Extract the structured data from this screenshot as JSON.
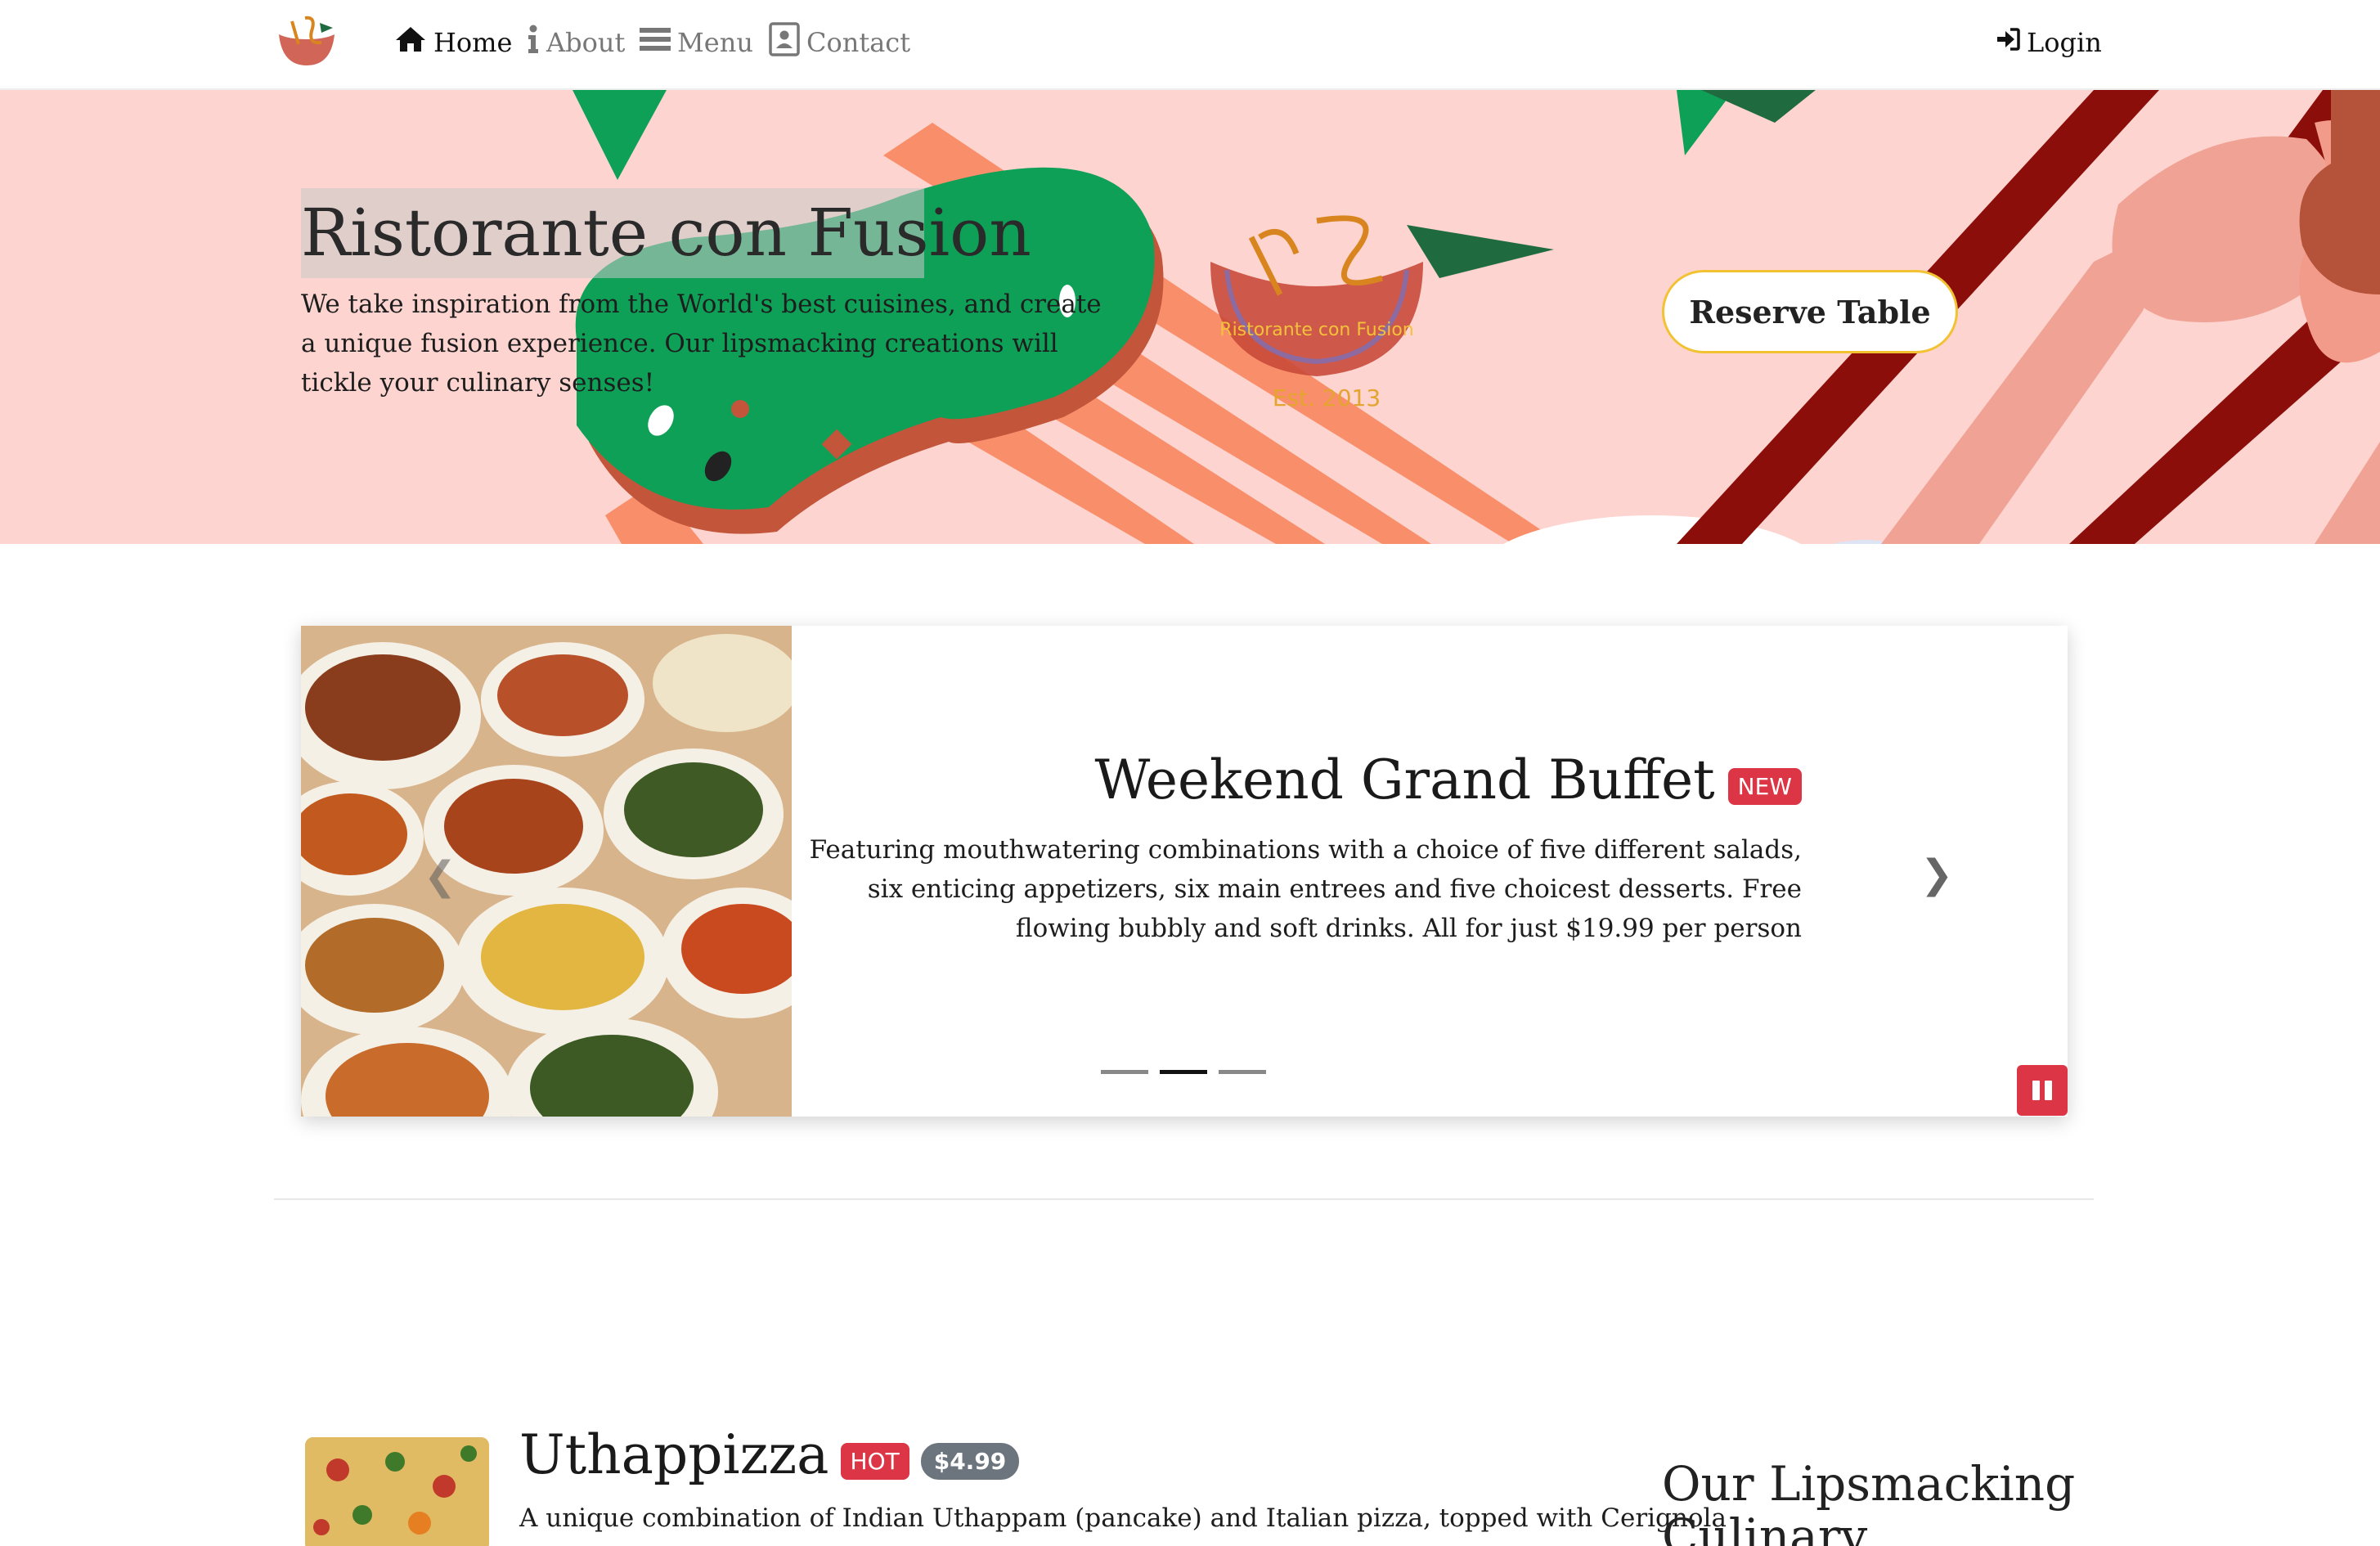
{
  "navbar": {
    "home": "Home",
    "about": "About",
    "menu": "Menu",
    "contact": "Contact",
    "login": "Login",
    "logo_text": "Est. 2013"
  },
  "jumbotron": {
    "title": "Ristorante con Fusion",
    "text": "We take inspiration from the World's best cuisines, and create a unique fusion experience. Our lipsmacking creations will tickle your culinary senses!",
    "logo_name": "Ristorante con Fusion",
    "logo_est": "Est. 2013",
    "reserve_label": "Reserve Table"
  },
  "carousel": {
    "heading": "Weekend Grand Buffet",
    "badge": "NEW",
    "description": "Featuring mouthwatering combinations with a choice of five different salads, six enticing appetizers, six main entrees and five choicest desserts. Free flowing bubbly and soft drinks. All for just $19.99 per person",
    "active_index": 1,
    "slide_count": 3
  },
  "media": {
    "title": "Uthappizza",
    "badge_hot": "HOT",
    "price": "$4.99",
    "description": "A unique combination of Indian Uthappam (pancake) and Italian pizza, topped with Cerignola"
  },
  "sidebar": {
    "heading": "Our Lipsmacking Culinary Creations"
  },
  "colors": {
    "jumbotron_bg": "#fdd4cf",
    "badge_red": "#dc3545",
    "badge_gray": "#6c757d",
    "reserve_border": "#f2c233"
  }
}
